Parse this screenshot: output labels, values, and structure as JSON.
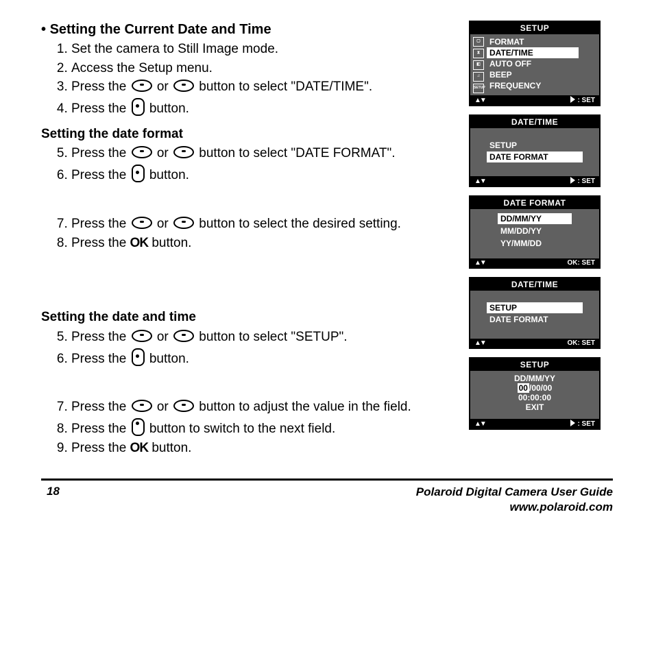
{
  "main": {
    "title": "Setting the Current Date and Time",
    "steps1": {
      "s1": "Set the camera to Still Image mode.",
      "s2": "Access the Setup menu.",
      "s3a": "Press the ",
      "s3b": " or ",
      "s3c": " button to select \"DATE/TIME\".",
      "s4a": "Press the ",
      "s4b": " button."
    },
    "sub1": "Setting the date format",
    "steps2": {
      "s5a": "Press the ",
      "s5b": " or ",
      "s5c": " button to select \"DATE FORMAT\".",
      "s6a": "Press the ",
      "s6b": " button."
    },
    "steps3": {
      "s7a": "Press the ",
      "s7b": " or ",
      "s7c": " button to select the desired setting.",
      "s8a": "Press the ",
      "s8b": " button.",
      "ok": "OK"
    },
    "sub2": "Setting the date and time",
    "steps4": {
      "s5a": "Press the ",
      "s5b": " or ",
      "s5c": " button to select \"SETUP\".",
      "s6a": "Press the ",
      "s6b": " button."
    },
    "steps5": {
      "s7a": "Press the ",
      "s7b": " or ",
      "s7c": " button to adjust the value in the field.",
      "s8a": "Press the ",
      "s8b": " button to switch to the next field.",
      "s9a": "Press the ",
      "s9b": " button.",
      "ok": "OK"
    }
  },
  "screens": {
    "s1": {
      "title": "SETUP",
      "items": [
        "FORMAT",
        "DATE/TIME",
        "AUTO OFF",
        "BEEP",
        "FREQUENCY"
      ],
      "footer": ": SET",
      "nav": "▲▼"
    },
    "s2": {
      "title": "DATE/TIME",
      "items": [
        "SETUP",
        "DATE FORMAT"
      ],
      "footer": ": SET",
      "nav": "▲▼"
    },
    "s3": {
      "title": "DATE FORMAT",
      "items": [
        "DD/MM/YY",
        "MM/DD/YY",
        "YY/MM/DD"
      ],
      "footer": "OK: SET",
      "nav": "▲▼"
    },
    "s4": {
      "title": "DATE/TIME",
      "items": [
        "SETUP",
        "DATE FORMAT"
      ],
      "footer": "OK: SET",
      "nav": "▲▼"
    },
    "s5": {
      "title": "SETUP",
      "line1": "DD/MM/YY",
      "f1": "00",
      "rest1": "/00/00",
      "line3": "00:00:00",
      "exit": "EXIT",
      "footer": ": SET",
      "nav": "▲▼"
    }
  },
  "footer": {
    "page": "18",
    "line1": "Polaroid Digital Camera User Guide",
    "line2": "www.polaroid.com"
  }
}
